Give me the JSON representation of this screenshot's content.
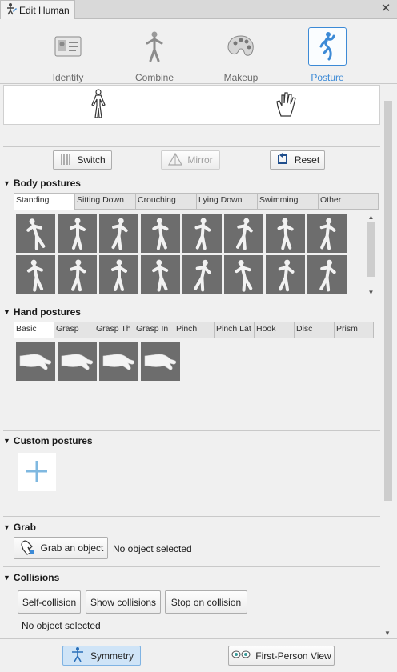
{
  "window": {
    "title": "Edit Human"
  },
  "main_tabs": [
    {
      "label": "Identity",
      "icon": "id-card-icon",
      "selected": false
    },
    {
      "label": "Combine",
      "icon": "mannequin-icon",
      "selected": false
    },
    {
      "label": "Makeup",
      "icon": "palette-icon",
      "selected": false
    },
    {
      "label": "Posture",
      "icon": "posture-icon",
      "selected": true
    }
  ],
  "sub_tabs": [
    {
      "icon": "body-icon",
      "selected": true
    },
    {
      "icon": "hand-icon",
      "selected": false
    }
  ],
  "toolbar": {
    "switch": "Switch",
    "mirror": "Mirror",
    "reset": "Reset"
  },
  "body_postures": {
    "title": "Body postures",
    "tabs": [
      "Standing",
      "Sitting Down",
      "Crouching",
      "Lying Down",
      "Swimming",
      "Other"
    ],
    "selected_tab": "Standing"
  },
  "hand_postures": {
    "title": "Hand postures",
    "tabs": [
      "Basic",
      "Grasp",
      "Grasp Th",
      "Grasp In",
      "Pinch",
      "Pinch Lat",
      "Hook",
      "Disc",
      "Prism"
    ],
    "selected_tab": "Basic"
  },
  "custom_postures": {
    "title": "Custom postures"
  },
  "grab": {
    "title": "Grab",
    "button": "Grab an object",
    "status": "No object selected"
  },
  "collisions": {
    "title": "Collisions",
    "buttons": [
      "Self-collision",
      "Show collisions",
      "Stop on collision"
    ],
    "status": "No object selected"
  },
  "footer": {
    "symmetry": "Symmetry",
    "first_person": "First-Person View"
  },
  "colors": {
    "accent": "#3c8ad6",
    "thumb_bg": "#6d6d6d",
    "panel": "#f0f0f0"
  }
}
